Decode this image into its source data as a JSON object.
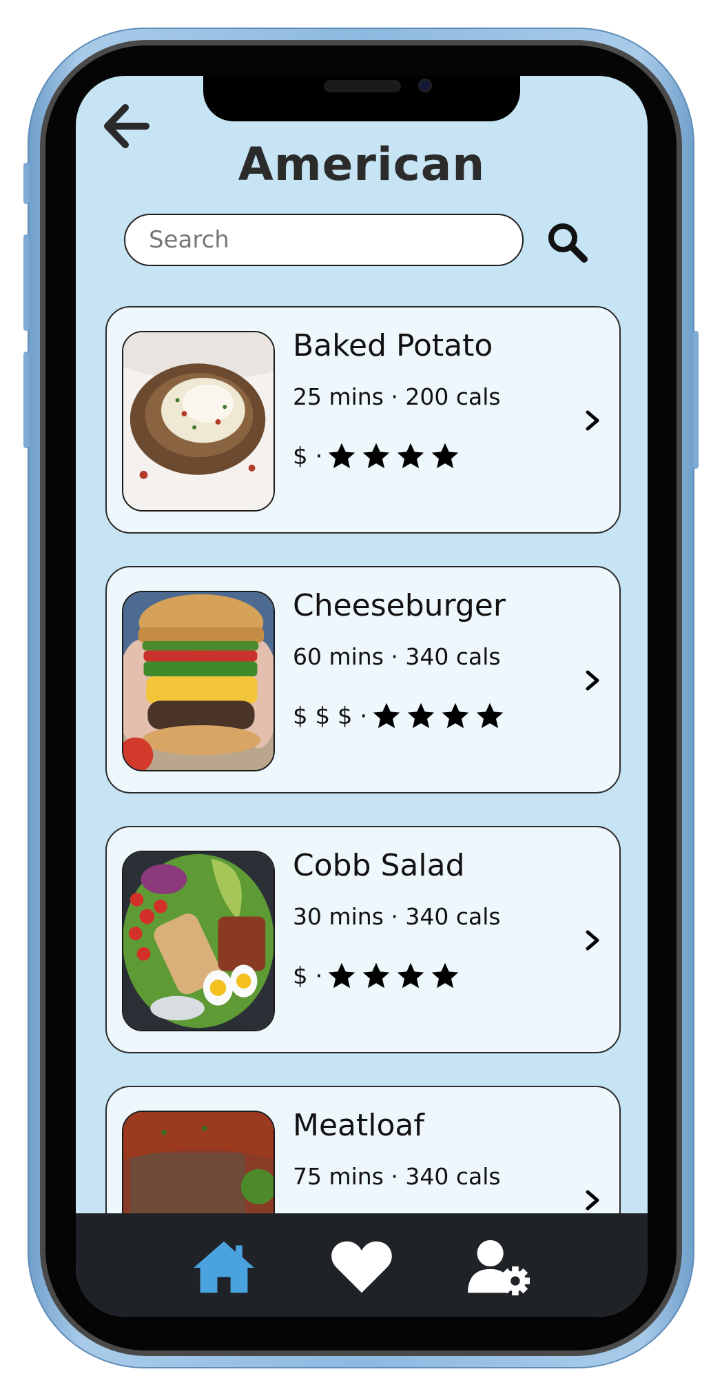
{
  "page": {
    "title": "American",
    "back_icon": "arrow-left-icon"
  },
  "search": {
    "placeholder": "Search",
    "value": "",
    "icon": "search-icon"
  },
  "recipes": [
    {
      "name": "Baked Potato",
      "meta": "25 mins · 200 cals",
      "price": "$ ·",
      "stars": 4,
      "image": "baked-potato-photo"
    },
    {
      "name": "Cheeseburger",
      "meta": "60 mins · 340 cals",
      "price": "$ $ $ ·",
      "stars": 4,
      "image": "cheeseburger-photo"
    },
    {
      "name": "Cobb Salad",
      "meta": "30 mins · 340 cals",
      "price": "$ ·",
      "stars": 4,
      "image": "cobb-salad-photo"
    },
    {
      "name": "Meatloaf",
      "meta": "75 mins · 340 cals",
      "price": "",
      "stars": 0,
      "image": "meatloaf-photo"
    }
  ],
  "bottom_nav": {
    "items": [
      {
        "name": "home",
        "icon": "home-icon",
        "active": true
      },
      {
        "name": "favorites",
        "icon": "heart-icon",
        "active": false
      },
      {
        "name": "account-settings",
        "icon": "user-gear-icon",
        "active": false
      }
    ]
  },
  "colors": {
    "screen_background": "#c6e4f4",
    "card_background": "#eef7fb",
    "nav_background": "#1f2226",
    "nav_active": "#4aa3df",
    "nav_inactive": "#ffffff",
    "phone_body": "#8db9e0"
  }
}
